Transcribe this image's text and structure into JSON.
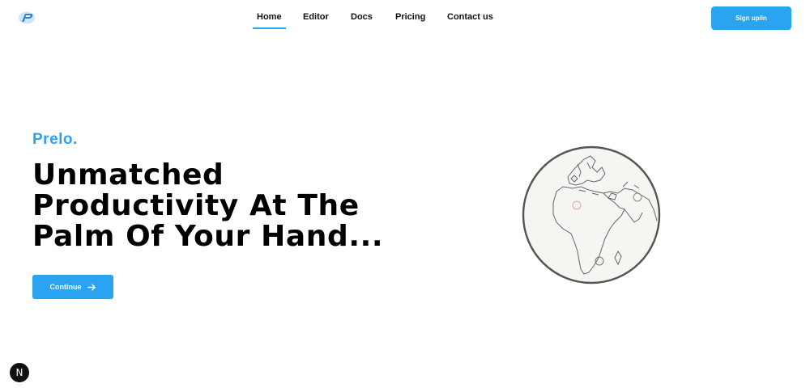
{
  "nav": {
    "items": [
      {
        "label": "Home",
        "active": true
      },
      {
        "label": "Editor",
        "active": false
      },
      {
        "label": "Docs",
        "active": false
      },
      {
        "label": "Pricing",
        "active": false
      },
      {
        "label": "Contact us",
        "active": false
      }
    ],
    "signup_label": "Sign up/in"
  },
  "hero": {
    "brand": "Prelo.",
    "headline_lines": [
      "Unmatched",
      "Productivity At The",
      "Palm Of Your Hand..."
    ],
    "cta_label": "Continue"
  },
  "dev_badge": {
    "label": "N"
  },
  "colors": {
    "accent": "#2aa3f0",
    "text": "#000000",
    "background": "#ffffff",
    "globe_fill": "#f7f5f2"
  },
  "icons": [
    "prelo-logo-icon",
    "arrow-right-icon",
    "globe-illustration",
    "next-badge-icon"
  ]
}
